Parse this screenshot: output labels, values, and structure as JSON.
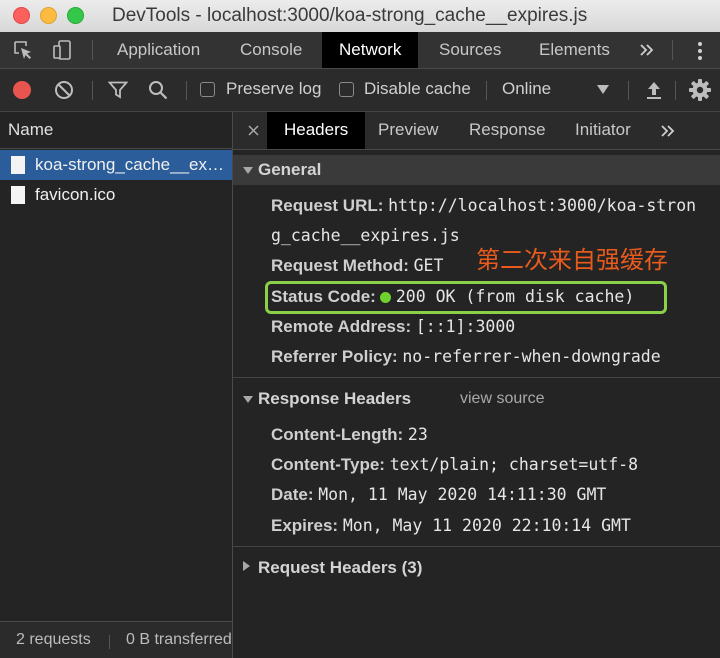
{
  "window": {
    "title": "DevTools - localhost:3000/koa-strong_cache__expires.js"
  },
  "main_tabs": [
    {
      "label": "Application"
    },
    {
      "label": "Console"
    },
    {
      "label": "Network"
    },
    {
      "label": "Sources"
    },
    {
      "label": "Elements"
    }
  ],
  "toolbar": {
    "preserve_log": "Preserve log",
    "disable_cache": "Disable cache",
    "throttle": "Online"
  },
  "requests": {
    "header": "Name",
    "items": [
      {
        "name": "koa-strong_cache__expires.js"
      },
      {
        "name": "favicon.ico"
      }
    ],
    "footer": {
      "count": "2 requests",
      "transferred": "0 B transferred"
    }
  },
  "detail_tabs": [
    {
      "label": "Headers"
    },
    {
      "label": "Preview"
    },
    {
      "label": "Response"
    },
    {
      "label": "Initiator"
    }
  ],
  "general": {
    "title": "General",
    "request_url_label": "Request URL:",
    "request_url_line1": "http://localhost:3000/koa-stron",
    "request_url_line2": "g_cache__expires.js",
    "request_method_label": "Request Method:",
    "request_method": "GET",
    "status_code_label": "Status Code:",
    "status_code": "200 OK (from disk cache)",
    "status_color": "#6fd12e",
    "remote_address_label": "Remote Address:",
    "remote_address": "[::1]:3000",
    "referrer_policy_label": "Referrer Policy:",
    "referrer_policy": "no-referrer-when-downgrade"
  },
  "annotation": {
    "text": "第二次来自强缓存",
    "color": "#e85b1c"
  },
  "response_headers": {
    "title": "Response Headers",
    "view_source": "view source",
    "content_length_label": "Content-Length:",
    "content_length": "23",
    "content_type_label": "Content-Type:",
    "content_type": "text/plain; charset=utf-8",
    "date_label": "Date:",
    "date": "Mon, 11 May 2020 14:11:30 GMT",
    "expires_label": "Expires:",
    "expires": "Mon, May 11 2020 22:10:14 GMT"
  },
  "request_headers": {
    "title": "Request Headers (3)"
  }
}
